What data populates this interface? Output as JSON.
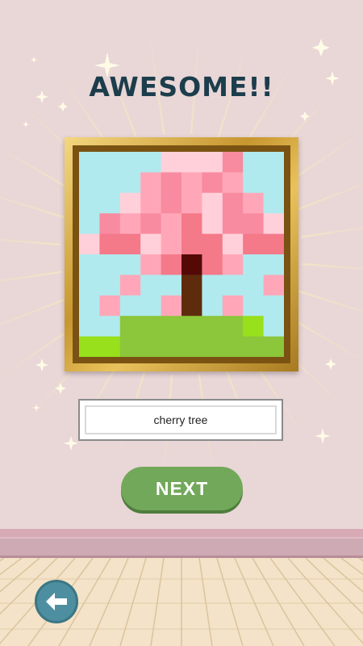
{
  "title": "AWESOME!!",
  "artwork": {
    "name": "cherry tree",
    "grid_size": 10,
    "palette": {
      "S": "#b0eaee",
      "A": "#ffd0da",
      "B": "#ffa7b8",
      "C": "#f88ba0",
      "D": "#f47989",
      "E": "#540907",
      "F": "#5e2c0c",
      "G": "#8cc63a",
      "H": "#98df1c"
    },
    "rows": [
      "SSSSAAACSS",
      "SSSBCBCBSS",
      "SSABCBACBS",
      "SCBCBDACCA",
      "ADDABDDADD",
      "SSSBDEDBSS",
      "SSBSSFSSSB",
      "SBSSBFSBSS",
      "SSGGGGGGHS",
      "HHGGGGGGGG"
    ]
  },
  "next_button": {
    "label": "NEXT"
  },
  "back_button": {
    "icon": "back-arrow-icon"
  },
  "colors": {
    "title": "#1c3d4b",
    "next_button": "#72a85a",
    "back_button": "#4d8fa0",
    "wall": "#e9d6d7",
    "frame_gold": "#d4a640"
  }
}
